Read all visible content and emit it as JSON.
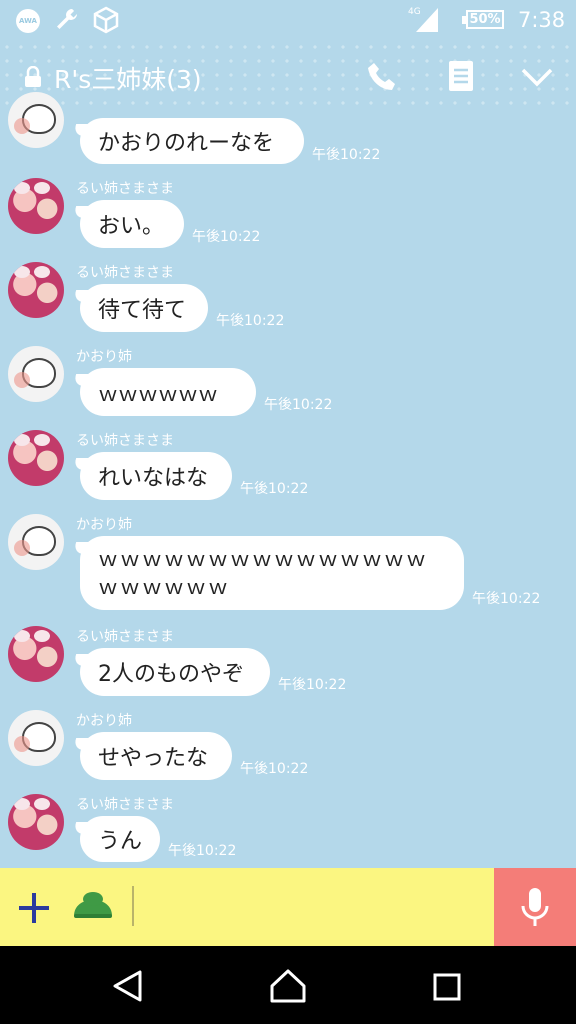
{
  "status_bar": {
    "awa_label": "AWA",
    "network": "4G",
    "battery": "50%",
    "time": "7:38"
  },
  "header": {
    "title": "R's三姉妹(3)"
  },
  "messages": [
    {
      "sender": "",
      "text": "かおりのれーなを",
      "time": "午後10:22"
    },
    {
      "sender": "るい姉さまさま",
      "text": "おい。",
      "time": "午後10:22"
    },
    {
      "sender": "るい姉さまさま",
      "text": "待て待て",
      "time": "午後10:22"
    },
    {
      "sender": "かおり姉",
      "text": "ｗｗｗｗｗｗ",
      "time": "午後10:22"
    },
    {
      "sender": "るい姉さまさま",
      "text": "れいなはな",
      "time": "午後10:22"
    },
    {
      "sender": "かおり姉",
      "text": "ｗｗｗｗｗｗｗｗｗｗｗｗｗｗｗｗｗｗｗｗｗ",
      "time": "午後10:22"
    },
    {
      "sender": "るい姉さまさま",
      "text": "2人のものやぞ",
      "time": "午後10:22"
    },
    {
      "sender": "かおり姉",
      "text": "せやったな",
      "time": "午後10:22"
    },
    {
      "sender": "るい姉さまさま",
      "text": "うん",
      "time": "午後10:22"
    }
  ],
  "colors": {
    "background": "#b4d8ea",
    "input_bar": "#fbf681",
    "mic_button": "#f47d78",
    "icon_blue": "#2b3a9e",
    "sticker_green": "#3f9a45"
  },
  "icons": [
    "lock-icon",
    "phone-icon",
    "notes-icon",
    "chevron-down-icon",
    "plus-icon",
    "sticker-icon",
    "mic-icon",
    "back-icon",
    "home-icon",
    "recent-apps-icon"
  ]
}
